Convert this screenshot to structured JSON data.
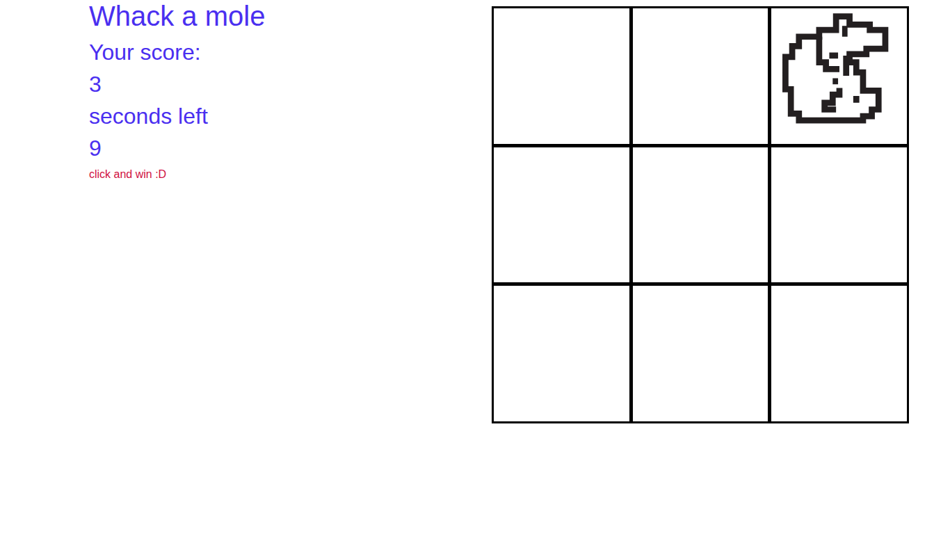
{
  "title": "Whack a mole",
  "score": {
    "label": "Your score:",
    "value": "3"
  },
  "timer": {
    "label": "seconds left",
    "value": "9"
  },
  "tagline": "click and win :D",
  "cells": [
    {
      "mole": false
    },
    {
      "mole": false
    },
    {
      "mole": true
    },
    {
      "mole": false
    },
    {
      "mole": false
    },
    {
      "mole": false
    },
    {
      "mole": false
    },
    {
      "mole": false
    },
    {
      "mole": false
    }
  ]
}
